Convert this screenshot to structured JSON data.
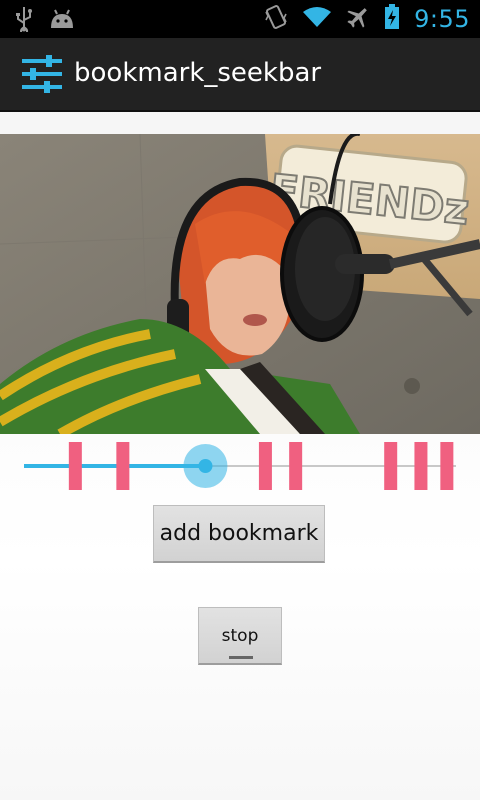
{
  "status_bar": {
    "time": "9:55",
    "icons": [
      "usb-icon",
      "android-debug-icon",
      "vibrate-icon",
      "wifi-icon",
      "airplane-mode-icon",
      "battery-charging-icon"
    ],
    "accent_color": "#33b5e5"
  },
  "action_bar": {
    "title": "bookmark_seekbar",
    "icon": "sliders-icon",
    "background": "#222222"
  },
  "video": {
    "sign_text": "FRIENDz"
  },
  "seekbar": {
    "progress": 0.42,
    "bookmarks": [
      0.12,
      0.23,
      0.56,
      0.63,
      0.85,
      0.92,
      0.98
    ],
    "progress_color": "#33b5e5",
    "bookmark_color": "#f06080"
  },
  "buttons": {
    "add_bookmark": "add bookmark",
    "stop": "stop"
  }
}
